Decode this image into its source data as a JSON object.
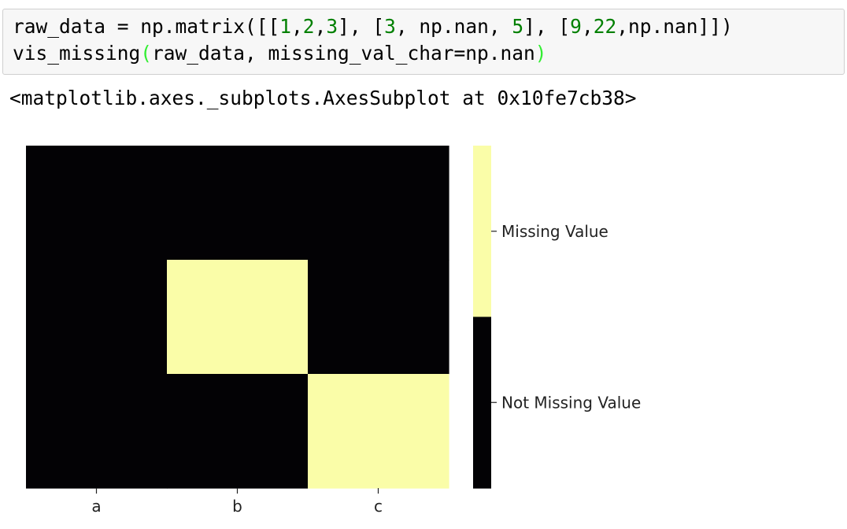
{
  "cell": {
    "line1_parts": [
      {
        "t": "raw_data = np.matrix([[",
        "c": ""
      },
      {
        "t": "1",
        "c": "num"
      },
      {
        "t": ",",
        "c": ""
      },
      {
        "t": "2",
        "c": "num"
      },
      {
        "t": ",",
        "c": ""
      },
      {
        "t": "3",
        "c": "num"
      },
      {
        "t": "], [",
        "c": ""
      },
      {
        "t": "3",
        "c": "num"
      },
      {
        "t": ", np.nan, ",
        "c": ""
      },
      {
        "t": "5",
        "c": "num"
      },
      {
        "t": "], [",
        "c": ""
      },
      {
        "t": "9",
        "c": "num"
      },
      {
        "t": ",",
        "c": ""
      },
      {
        "t": "22",
        "c": "num"
      },
      {
        "t": ",np.nan]])",
        "c": ""
      }
    ],
    "line2_parts": [
      {
        "t": "vis_missing",
        "c": ""
      },
      {
        "t": "(",
        "c": "paren-hl"
      },
      {
        "t": "raw_data, missing_val_char=np.nan",
        "c": ""
      },
      {
        "t": ")",
        "c": "paren-hl"
      }
    ]
  },
  "output": {
    "text": "<matplotlib.axes._subplots.AxesSubplot at 0x10fe7cb38>"
  },
  "colors": {
    "missing": "#fafda8",
    "not_missing": "#030205",
    "number": "#008000",
    "paren_highlight": "#33ee33"
  },
  "chart_data": {
    "type": "heatmap",
    "columns": [
      "a",
      "b",
      "c"
    ],
    "rows": 3,
    "matrix": [
      [
        0,
        0,
        0
      ],
      [
        0,
        1,
        0
      ],
      [
        0,
        0,
        1
      ]
    ],
    "colorbar": {
      "labels": [
        "Missing Value",
        "Not Missing Value"
      ],
      "values": [
        1,
        0
      ]
    }
  }
}
